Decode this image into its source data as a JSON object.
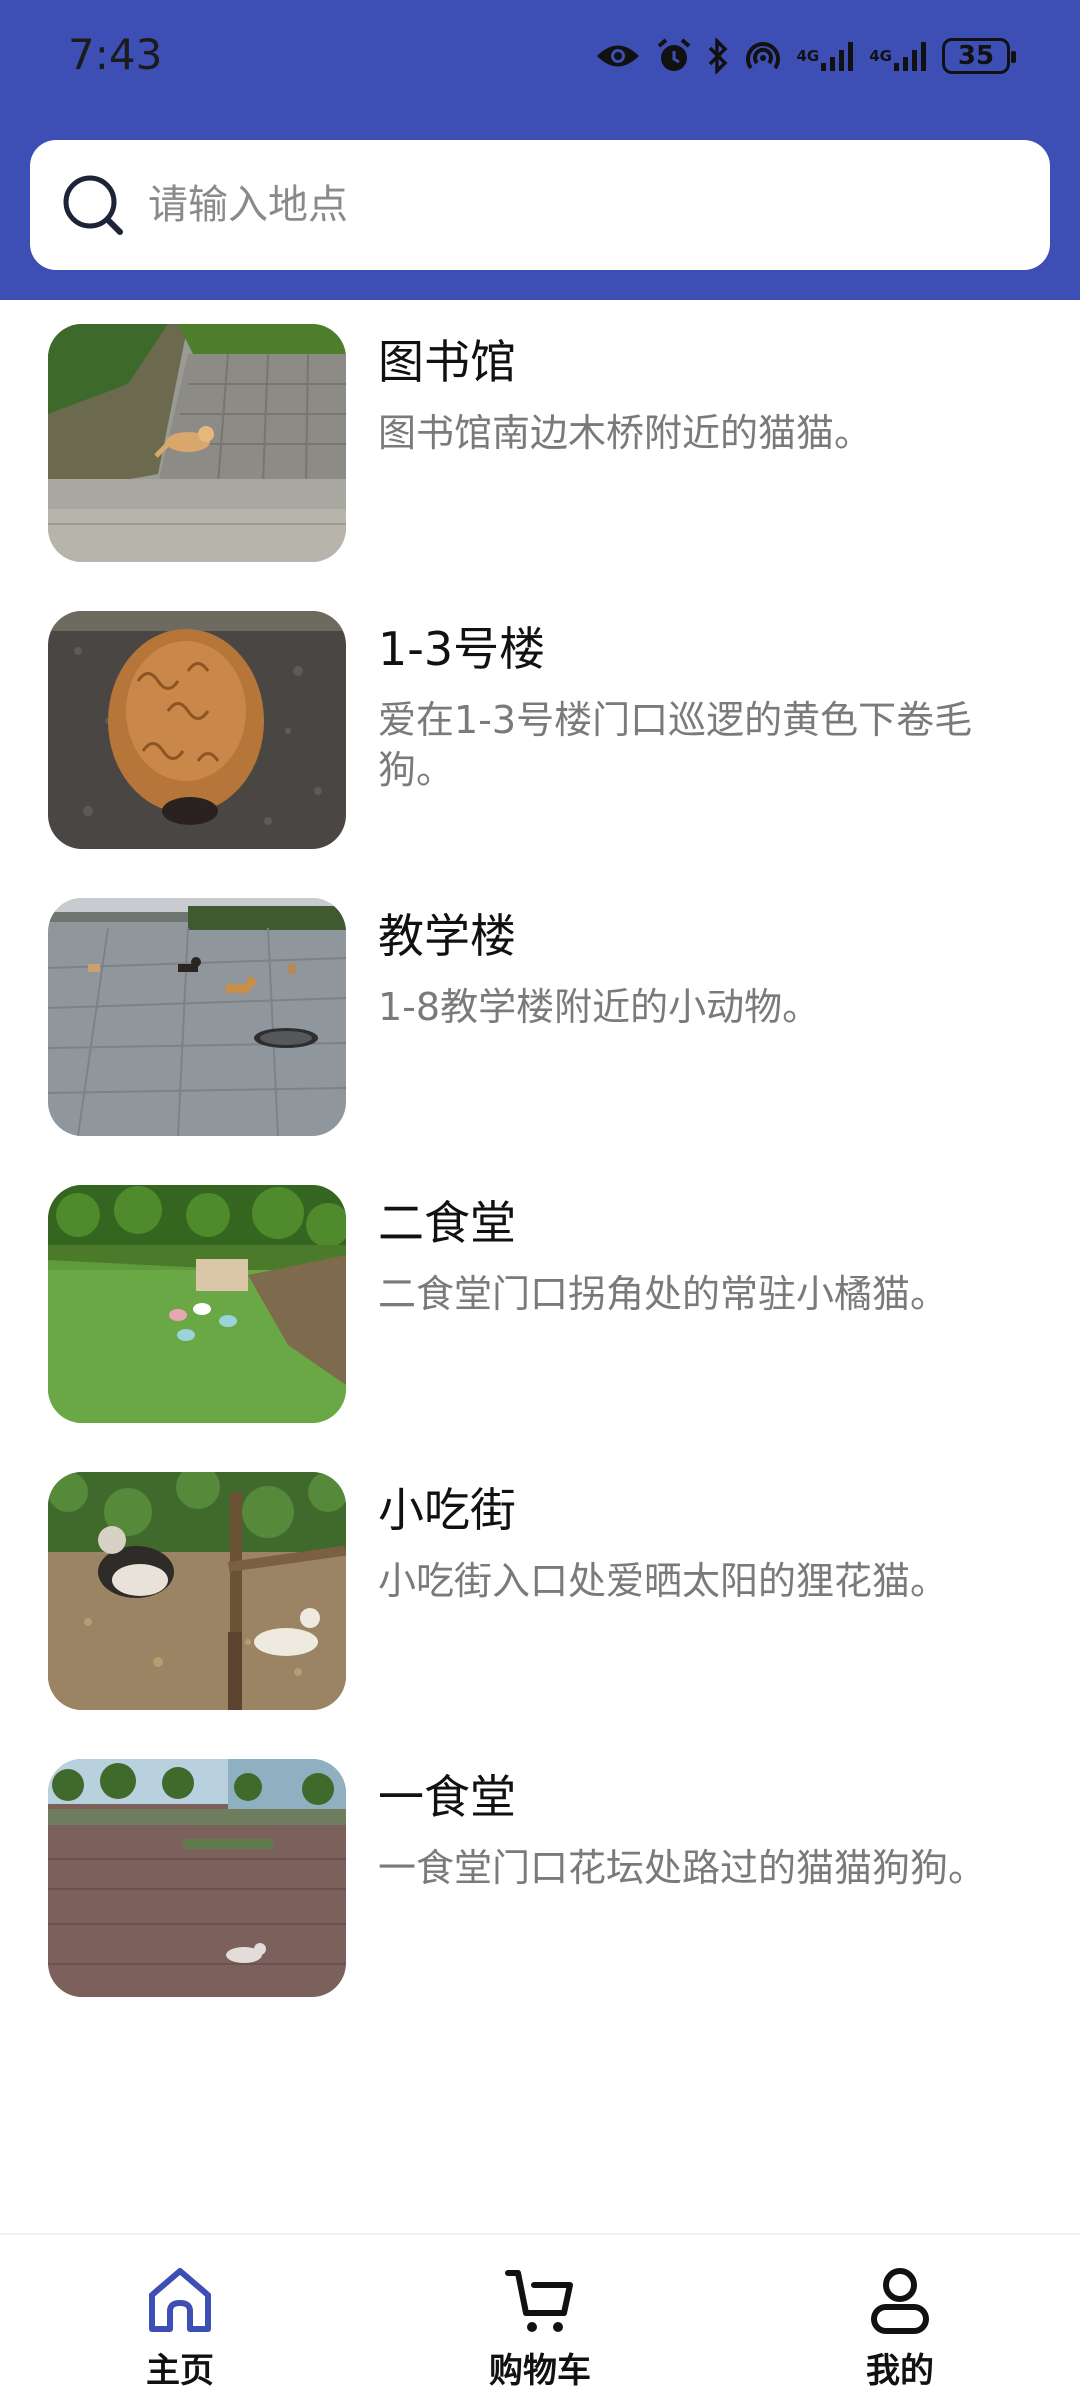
{
  "status_bar": {
    "time": "7:43",
    "battery": "35",
    "network_labels": [
      "4G",
      "4G"
    ],
    "icons": [
      "eye-icon",
      "alarm-icon",
      "bluetooth-icon",
      "hotspot-icon",
      "signal-icon",
      "signal-icon",
      "battery-icon"
    ]
  },
  "search": {
    "placeholder": "请输入地点",
    "value": ""
  },
  "colors": {
    "header": "#3d4fb5",
    "active_nav": "#3d4fb5"
  },
  "items": [
    {
      "title": "图书馆",
      "desc": "图书馆南边木桥附近的猫猫。",
      "image": "cat-on-sidewalk-photo"
    },
    {
      "title": "1-3号楼",
      "desc": "爱在1-3号楼门口巡逻的黄色下卷毛狗。",
      "image": "curly-dog-photo"
    },
    {
      "title": "教学楼",
      "desc": "1-8教学楼附近的小动物。",
      "image": "dogs-on-plaza-photo"
    },
    {
      "title": "二食堂",
      "desc": "二食堂门口拐角处的常驻小橘猫。",
      "image": "lawn-with-bowls-photo"
    },
    {
      "title": "小吃街",
      "desc": "小吃街入口处爱晒太阳的狸花猫。",
      "image": "cats-under-tree-photo"
    },
    {
      "title": "一食堂",
      "desc": "一食堂门口花坛处路过的猫猫狗狗。",
      "image": "cat-on-brick-square-photo"
    }
  ],
  "nav": [
    {
      "label": "主页",
      "icon": "home-icon",
      "active": true
    },
    {
      "label": "购物车",
      "icon": "cart-icon",
      "active": false
    },
    {
      "label": "我的",
      "icon": "profile-icon",
      "active": false
    }
  ]
}
